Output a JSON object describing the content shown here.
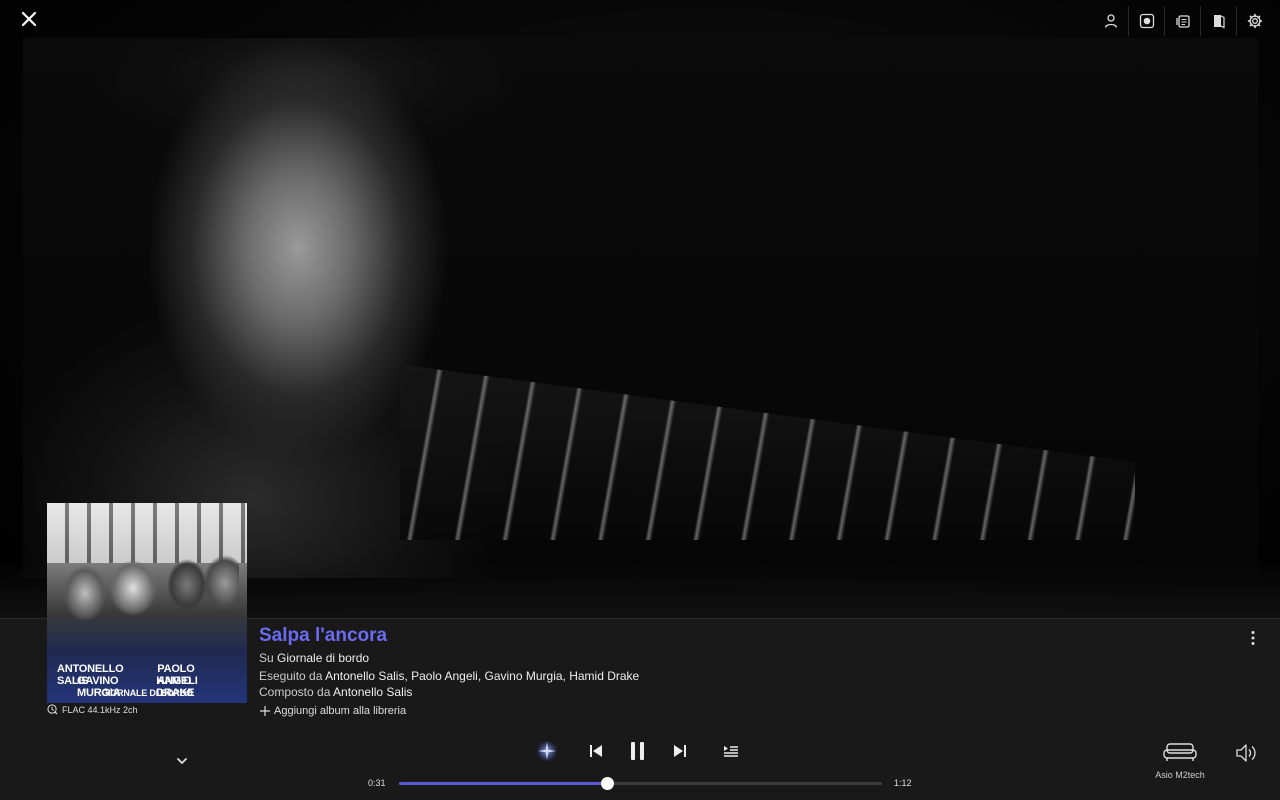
{
  "top_bar": {
    "close_icon": "close-icon",
    "buttons": [
      {
        "name": "account",
        "icon": "user-icon"
      },
      {
        "name": "record",
        "icon": "stop-record-icon"
      },
      {
        "name": "queue",
        "icon": "playlist-icon"
      },
      {
        "name": "booklet",
        "icon": "booklet-icon"
      },
      {
        "name": "settings",
        "icon": "gear-icon"
      }
    ]
  },
  "album_art": {
    "row1_left": "ANTONELLO SALIS",
    "row1_right": "PAOLO ANGELI",
    "row2_left": "GAVINO MURGIA",
    "row2_right": "HAMID DRAKE",
    "album": "GIORNALE DI BORDO"
  },
  "audio_quality": "FLAC 44.1kHz 2ch",
  "track": {
    "title": "Salpa l'ancora",
    "album_prefix": "Su",
    "album": "Giornale di bordo",
    "performers_prefix": "Eseguito da",
    "performers": "Antonello Salis, Paolo Angeli, Gavino Murgia, Hamid Drake",
    "composer_prefix": "Composto da",
    "composer": "Antonello Salis",
    "add_to_library": "Aggiungi album alla libreria"
  },
  "player": {
    "current_time": "0:31",
    "total_time": "1:12",
    "progress": 0.43,
    "is_playing": true
  },
  "output_device": {
    "name": "Asio M2tech"
  },
  "colors": {
    "accent": "#6b6bf0",
    "progress_fill": "#5a5ad6",
    "panel_bg": "#191919"
  }
}
